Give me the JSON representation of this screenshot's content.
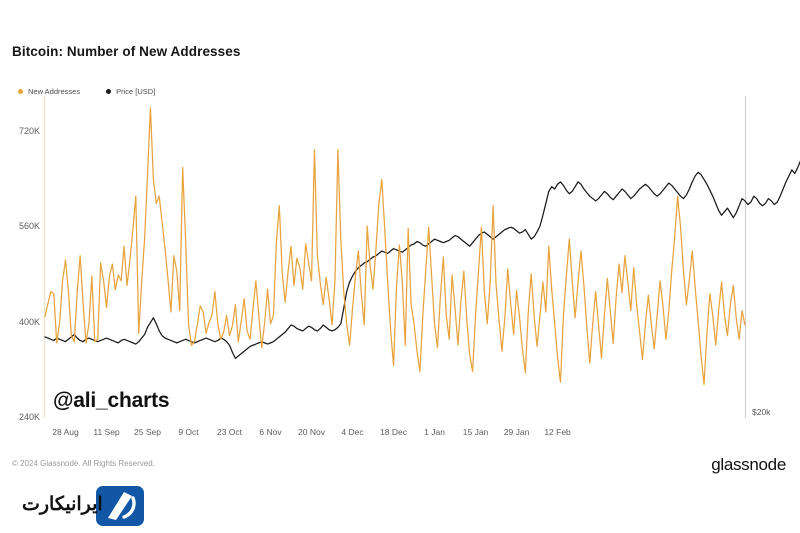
{
  "header": {
    "title": "Bitcoin: Number of New Addresses"
  },
  "watermark": {
    "handle": "@ali_charts"
  },
  "footer": {
    "copyright": "© 2024 Glassnode. All Rights Reserved.",
    "brand": "glassnode",
    "logo_text": "ایرانیکارت",
    "logo_name": "iranicard-logo",
    "logo_color": "#1257a6"
  },
  "colors": {
    "new_addresses": "#E8A33D",
    "price": "#1a1a1a",
    "left_axis": "#efe6d2",
    "right_axis": "#cfcfcf",
    "tick_text": "#5d5d5d",
    "background": "#ffffff"
  },
  "chart_data": {
    "type": "line",
    "title": "Bitcoin: Number of New Addresses",
    "xlabel": "",
    "ylabel": "New Addresses",
    "y2label": "Price [USD]",
    "grid": false,
    "legend_position": "top-left",
    "ylim": [
      240000,
      780000
    ],
    "yticks": [
      240000,
      400000,
      560000,
      720000
    ],
    "ytick_labels": [
      "240K",
      "400K",
      "560K",
      "720K"
    ],
    "y2_visible_tick_label": "$20k",
    "xticks": [
      "28 Aug",
      "11 Sep",
      "25 Sep",
      "9 Oct",
      "23 Oct",
      "6 Nov",
      "20 Nov",
      "4 Dec",
      "18 Dec",
      "1 Jan",
      "15 Jan",
      "29 Jan",
      "12 Feb"
    ],
    "x_range": [
      "21 Aug",
      "16 Feb"
    ],
    "series": [
      {
        "name": "New Addresses",
        "color": "#E8A33D",
        "axis": "left",
        "unit": "addresses",
        "values": [
          410000,
          432000,
          452000,
          448000,
          366000,
          400000,
          470000,
          505000,
          452000,
          378000,
          368000,
          452000,
          512000,
          432000,
          366000,
          398000,
          478000,
          368000,
          372000,
          500000,
          470000,
          425000,
          478000,
          498000,
          455000,
          480000,
          470000,
          528000,
          462000,
          505000,
          556000,
          612000,
          382000,
          468000,
          540000,
          648000,
          760000,
          640000,
          600000,
          612000,
          568000,
          524000,
          472000,
          418000,
          512000,
          486000,
          420000,
          660000,
          540000,
          398000,
          362000,
          368000,
          396000,
          428000,
          418000,
          382000,
          400000,
          412000,
          452000,
          398000,
          372000,
          384000,
          412000,
          378000,
          395000,
          430000,
          368000,
          402000,
          440000,
          386000,
          372000,
          422000,
          470000,
          412000,
          358000,
          400000,
          456000,
          398000,
          412000,
          535000,
          596000,
          482000,
          434000,
          486000,
          528000,
          462000,
          508000,
          492000,
          456000,
          532000,
          500000,
          470000,
          690000,
          512000,
          466000,
          430000,
          476000,
          440000,
          396000,
          470000,
          690000,
          538000,
          452000,
          398000,
          362000,
          424000,
          478000,
          520000,
          448000,
          396000,
          562000,
          496000,
          456000,
          524000,
          600000,
          640000,
          556000,
          468000,
          388000,
          328000,
          460000,
          530000,
          468000,
          362000,
          558000,
          430000,
          398000,
          352000,
          318000,
          412000,
          488000,
          560000,
          478000,
          398000,
          358000,
          444000,
          510000,
          412000,
          372000,
          480000,
          424000,
          362000,
          436000,
          486000,
          406000,
          346000,
          318000,
          412000,
          485000,
          560000,
          452000,
          398000,
          468000,
          596000,
          464000,
          406000,
          352000,
          408000,
          490000,
          432000,
          380000,
          454000,
          410000,
          356000,
          316000,
          418000,
          482000,
          412000,
          360000,
          412000,
          468000,
          418000,
          528000,
          456000,
          400000,
          342000,
          300000,
          412000,
          478000,
          540000,
          470000,
          408000,
          468000,
          520000,
          462000,
          392000,
          332000,
          398000,
          452000,
          396000,
          340000,
          412000,
          474000,
          420000,
          365000,
          442000,
          498000,
          450000,
          512000,
          468000,
          420000,
          492000,
          430000,
          385000,
          338000,
          398000,
          446000,
          398000,
          356000,
          412000,
          470000,
          428000,
          372000,
          420000,
          488000,
          544000,
          612000,
          560000,
          486000,
          430000,
          472000,
          520000,
          458000,
          402000,
          345000,
          296000,
          382000,
          448000,
          412000,
          362000,
          420000,
          468000,
          412000,
          378000,
          430000,
          462000,
          408000,
          372000,
          420000,
          396000
        ]
      },
      {
        "name": "Price [USD]",
        "color": "#1a1a1a",
        "axis": "right",
        "unit": "USD",
        "note": "Plotted on secondary axis; only the $20k tick label is visible",
        "values": [
          376000,
          374000,
          372000,
          370000,
          374000,
          372000,
          370000,
          368000,
          372000,
          376000,
          380000,
          374000,
          370000,
          368000,
          372000,
          374000,
          372000,
          370000,
          368000,
          370000,
          372000,
          374000,
          372000,
          370000,
          368000,
          366000,
          370000,
          372000,
          370000,
          368000,
          366000,
          364000,
          368000,
          374000,
          380000,
          392000,
          400000,
          408000,
          398000,
          386000,
          378000,
          374000,
          372000,
          370000,
          368000,
          366000,
          368000,
          370000,
          372000,
          370000,
          368000,
          366000,
          368000,
          370000,
          372000,
          374000,
          372000,
          370000,
          368000,
          370000,
          374000,
          372000,
          368000,
          362000,
          350000,
          340000,
          344000,
          348000,
          352000,
          356000,
          360000,
          362000,
          364000,
          366000,
          368000,
          366000,
          364000,
          366000,
          368000,
          372000,
          376000,
          380000,
          384000,
          390000,
          396000,
          394000,
          390000,
          388000,
          386000,
          390000,
          394000,
          392000,
          388000,
          386000,
          390000,
          396000,
          392000,
          388000,
          386000,
          388000,
          392000,
          398000,
          424000,
          452000,
          468000,
          478000,
          486000,
          492000,
          496000,
          500000,
          502000,
          506000,
          510000,
          512000,
          516000,
          520000,
          518000,
          516000,
          520000,
          524000,
          522000,
          520000,
          518000,
          522000,
          526000,
          530000,
          532000,
          536000,
          534000,
          530000,
          528000,
          532000,
          536000,
          540000,
          538000,
          536000,
          534000,
          536000,
          538000,
          542000,
          546000,
          544000,
          540000,
          536000,
          532000,
          528000,
          534000,
          540000,
          546000,
          550000,
          552000,
          548000,
          544000,
          540000,
          544000,
          548000,
          552000,
          556000,
          558000,
          560000,
          558000,
          554000,
          550000,
          552000,
          556000,
          548000,
          540000,
          544000,
          552000,
          562000,
          580000,
          600000,
          620000,
          628000,
          624000,
          632000,
          636000,
          630000,
          622000,
          616000,
          620000,
          628000,
          636000,
          632000,
          624000,
          618000,
          612000,
          608000,
          604000,
          608000,
          614000,
          620000,
          616000,
          610000,
          606000,
          612000,
          618000,
          624000,
          620000,
          614000,
          608000,
          612000,
          618000,
          624000,
          628000,
          632000,
          628000,
          622000,
          616000,
          612000,
          616000,
          622000,
          628000,
          634000,
          630000,
          624000,
          618000,
          612000,
          608000,
          614000,
          624000,
          636000,
          646000,
          652000,
          648000,
          640000,
          632000,
          622000,
          612000,
          600000,
          588000,
          580000,
          586000,
          592000,
          584000,
          576000,
          584000,
          596000,
          608000,
          604000,
          598000,
          602000,
          612000,
          608000,
          600000,
          596000,
          600000,
          608000,
          604000,
          598000,
          602000,
          612000,
          624000,
          636000,
          646000,
          656000,
          650000,
          660000,
          672000,
          684000,
          696000,
          692000,
          700000,
          708000,
          714000,
          712000,
          716000
        ]
      }
    ]
  }
}
